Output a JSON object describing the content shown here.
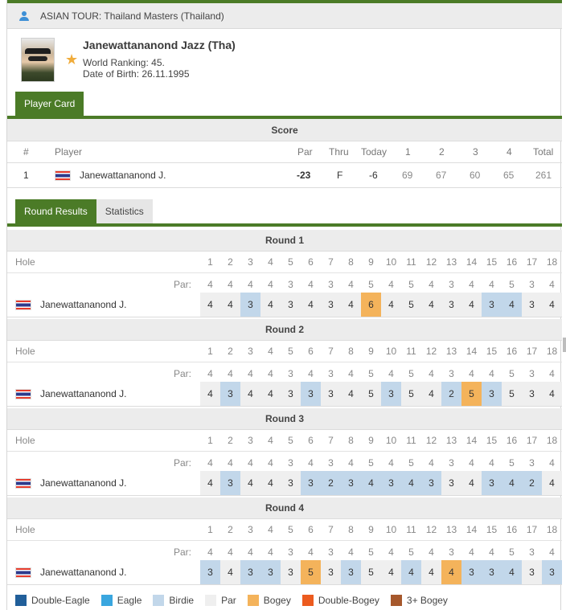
{
  "header": {
    "title": "ASIAN TOUR: Thailand Masters (Thailand)",
    "icon": "person-icon"
  },
  "player": {
    "name": "Janewattananond Jazz (Tha)",
    "world_ranking": "World Ranking: 45.",
    "dob": "Date of Birth: 26.11.1995",
    "star_icon": "star-icon"
  },
  "tabs_top": {
    "player_card": "Player Card"
  },
  "score": {
    "title": "Score",
    "columns": {
      "pos": "#",
      "player": "Player",
      "par": "Par",
      "thru": "Thru",
      "today": "Today",
      "r1": "1",
      "r2": "2",
      "r3": "3",
      "r4": "4",
      "total": "Total"
    },
    "row": {
      "pos": "1",
      "player": "Janewattananond J.",
      "par": "-23",
      "thru": "F",
      "today": "-6",
      "r1": "69",
      "r2": "67",
      "r3": "60",
      "r4": "65",
      "total": "261"
    }
  },
  "tabs_mid": {
    "round_results": "Round Results",
    "statistics": "Statistics"
  },
  "labels": {
    "hole": "Hole",
    "par": "Par:"
  },
  "holes": [
    "1",
    "2",
    "3",
    "4",
    "5",
    "6",
    "7",
    "8",
    "9",
    "10",
    "11",
    "12",
    "13",
    "14",
    "15",
    "16",
    "17",
    "18"
  ],
  "pars": [
    "4",
    "4",
    "4",
    "4",
    "3",
    "4",
    "3",
    "4",
    "5",
    "4",
    "5",
    "4",
    "3",
    "4",
    "4",
    "5",
    "3",
    "4"
  ],
  "rounds": [
    {
      "title": "Round 1",
      "player": "Janewattananond J.",
      "scores": [
        "4",
        "4",
        "3",
        "4",
        "3",
        "4",
        "3",
        "4",
        "6",
        "4",
        "5",
        "4",
        "3",
        "4",
        "3",
        "4",
        "3",
        "4"
      ]
    },
    {
      "title": "Round 2",
      "player": "Janewattananond J.",
      "scores": [
        "4",
        "3",
        "4",
        "4",
        "3",
        "3",
        "3",
        "4",
        "5",
        "3",
        "5",
        "4",
        "2",
        "5",
        "3",
        "5",
        "3",
        "4"
      ]
    },
    {
      "title": "Round 3",
      "player": "Janewattananond J.",
      "scores": [
        "4",
        "3",
        "4",
        "4",
        "3",
        "3",
        "2",
        "3",
        "4",
        "3",
        "4",
        "3",
        "3",
        "4",
        "3",
        "4",
        "2",
        "4"
      ]
    },
    {
      "title": "Round 4",
      "player": "Janewattananond J.",
      "scores": [
        "3",
        "4",
        "3",
        "3",
        "3",
        "5",
        "3",
        "3",
        "5",
        "4",
        "4",
        "4",
        "4",
        "3",
        "3",
        "4",
        "3",
        "3"
      ]
    }
  ],
  "legend": [
    {
      "label": "Double-Eagle",
      "color": "#215f9a"
    },
    {
      "label": "Eagle",
      "color": "#3aa6df"
    },
    {
      "label": "Birdie",
      "color": "#c2d7ea"
    },
    {
      "label": "Par",
      "color": "#efefef"
    },
    {
      "label": "Bogey",
      "color": "#f4b35b"
    },
    {
      "label": "Double-Bogey",
      "color": "#ec5b1f"
    },
    {
      "label": "3+ Bogey",
      "color": "#a6582c"
    }
  ],
  "colors": {
    "accent": "#4b7b27",
    "birdie": "#c2d7ea",
    "par": "#efefef",
    "bogey": "#f4b35b",
    "eagle": "#3aa6df"
  }
}
